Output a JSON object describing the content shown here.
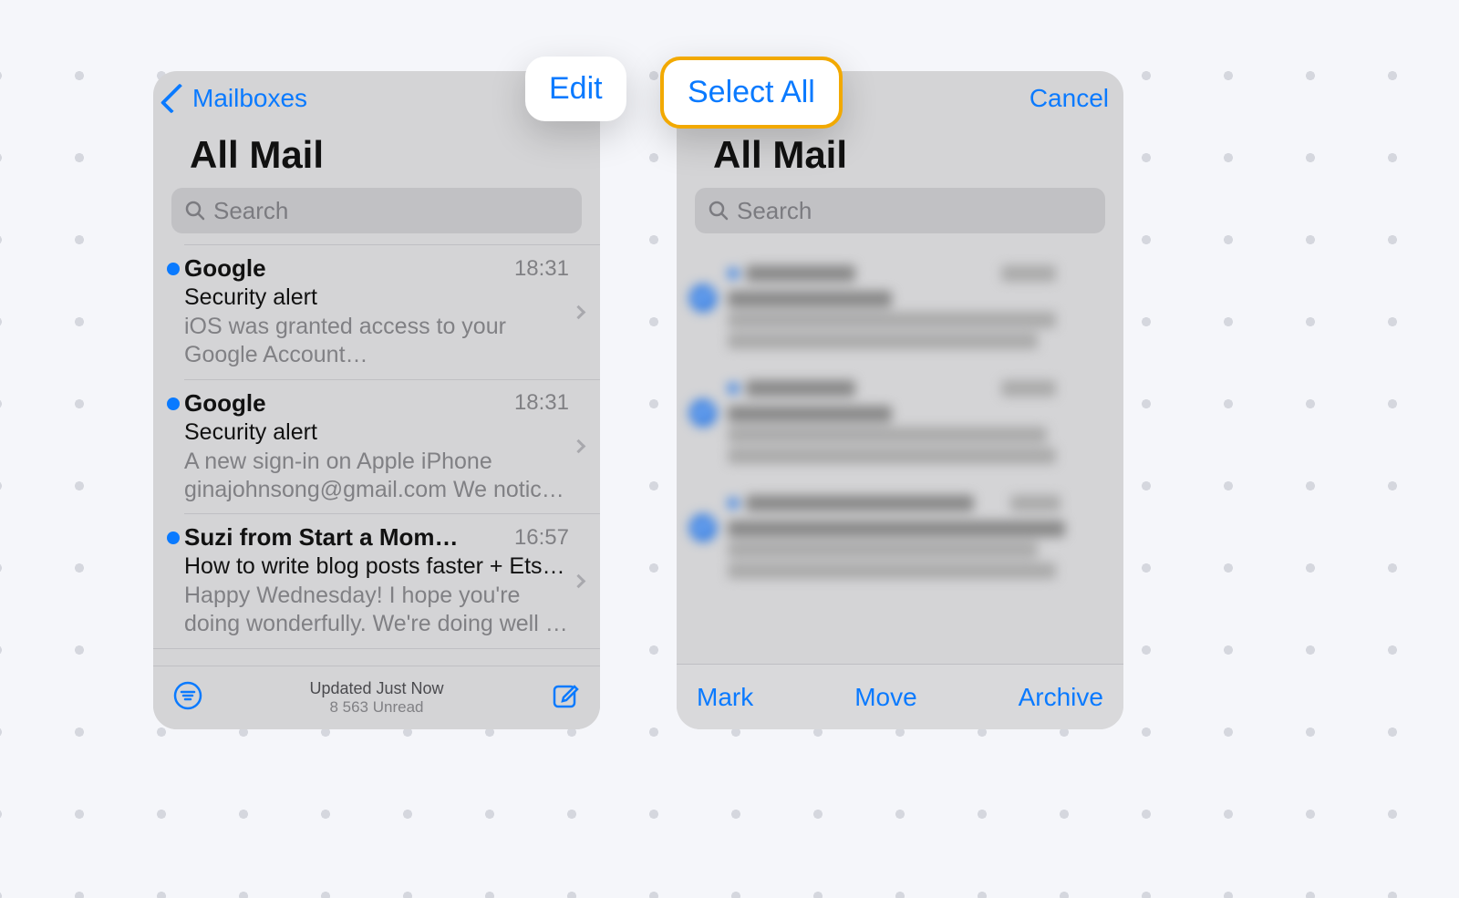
{
  "callouts": {
    "edit": "Edit",
    "select_all": "Select All"
  },
  "left": {
    "nav_back": "Mailboxes",
    "title": "All Mail",
    "search_placeholder": "Search",
    "toolbar": {
      "status_line1": "Updated Just Now",
      "status_line2": "8 563 Unread"
    },
    "messages": [
      {
        "sender": "Google",
        "time": "18:31",
        "subject": "Security alert",
        "preview": "iOS was granted access to your Google Account ginajohnsong@gmail.com If yo…"
      },
      {
        "sender": "Google",
        "time": "18:31",
        "subject": "Security alert",
        "preview": "A new sign-in on Apple iPhone ginajohnsong@gmail.com We noticed a…"
      },
      {
        "sender": "Suzi from Start a Mom…",
        "time": "16:57",
        "subject": "How to write blog posts faster + Etsy ti…",
        "preview": "Happy Wednesday! I hope you're doing wonderfully. We're doing well - the kids…"
      }
    ]
  },
  "right": {
    "nav_cancel": "Cancel",
    "title": "All Mail",
    "search_placeholder": "Search",
    "toolbar": {
      "mark": "Mark",
      "move": "Move",
      "archive": "Archive"
    }
  },
  "colors": {
    "ios_blue": "#0a7aff",
    "highlight_ring": "#f2a900"
  }
}
